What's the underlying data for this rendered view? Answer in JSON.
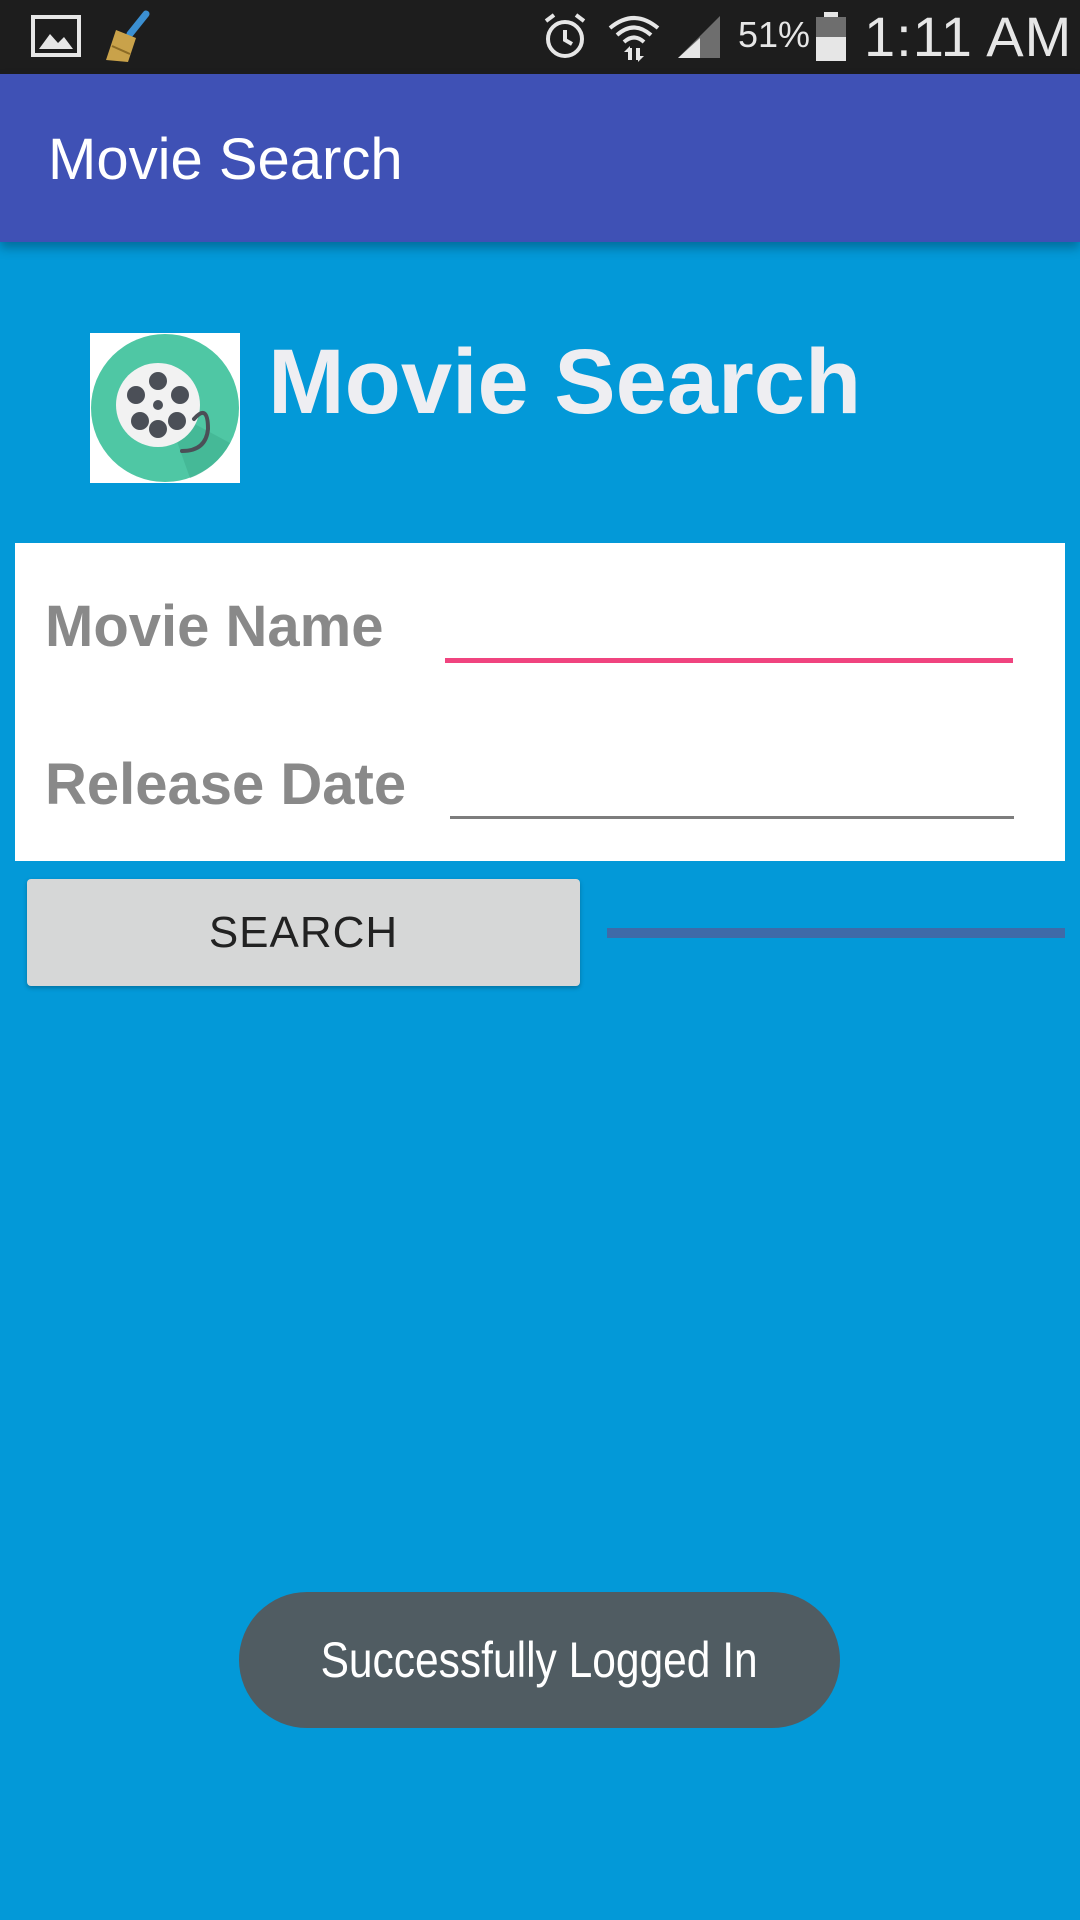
{
  "status_bar": {
    "battery": "51%",
    "time": "1:11 AM",
    "icons": [
      "gallery-icon",
      "cleaner-broom-icon",
      "alarm-icon",
      "wifi-icon",
      "signal-icon",
      "battery-icon"
    ]
  },
  "app_bar": {
    "title": "Movie Search"
  },
  "header": {
    "title": "Movie Search",
    "logo_icon": "film-reel-icon"
  },
  "form": {
    "movie_name": {
      "label": "Movie Name",
      "value": "",
      "placeholder": ""
    },
    "release_date": {
      "label": "Release Date",
      "value": "",
      "placeholder": ""
    }
  },
  "search_button": {
    "label": "SEARCH"
  },
  "progress": {
    "indeterminate": true
  },
  "toast": {
    "message": "Successfully Logged In"
  },
  "colors": {
    "status_bar": "#1D1D1D",
    "app_bar": "#3F51B5",
    "background": "#0399D8",
    "accent": "#F0447F",
    "toast": "#505C62",
    "button": "#D6D7D7"
  }
}
